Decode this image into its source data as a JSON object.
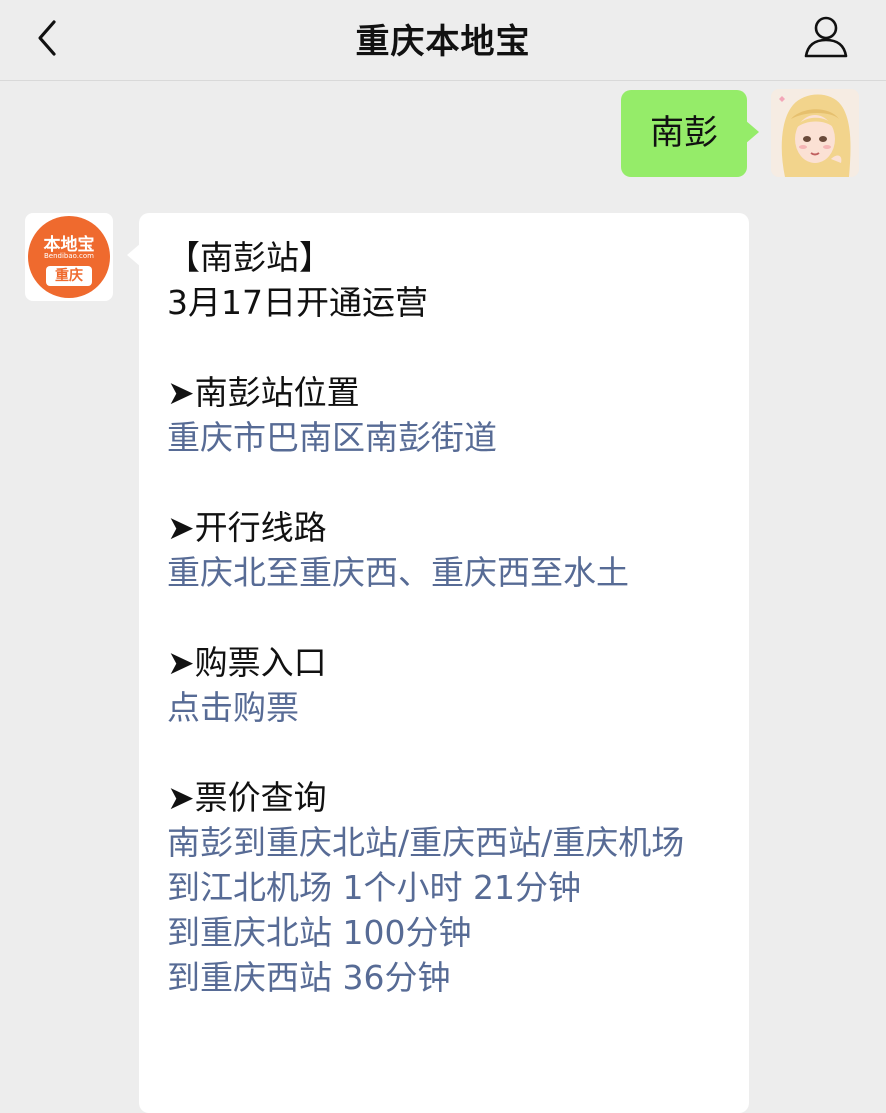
{
  "header": {
    "title": "重庆本地宝"
  },
  "chat": {
    "user_message": "南彭",
    "brand_avatar": {
      "name": "本地宝",
      "url": "Bendibao.com",
      "city": "重庆"
    },
    "reply": {
      "station_title": "【南彭站】",
      "opening": "3月17日开通运营",
      "location_heading": "➤南彭站位置",
      "location_value": "重庆市巴南区南彭街道",
      "routes_heading": "➤开行线路",
      "routes_value": "重庆北至重庆西、重庆西至水土",
      "ticket_heading": "➤购票入口",
      "ticket_link": "点击购票",
      "price_heading": "➤票价查询",
      "price_link": "南彭到重庆北站/重庆西站/重庆机场",
      "duration_airport": "到江北机场 1个小时 21分钟",
      "duration_north": "到重庆北站 100分钟",
      "duration_west": "到重庆西站 36分钟"
    }
  }
}
